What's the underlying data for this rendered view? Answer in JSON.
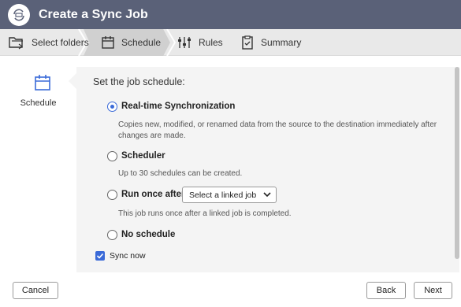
{
  "window": {
    "title": "Create a Sync Job"
  },
  "steps": [
    {
      "label": "Select folders",
      "icon": "folders-icon"
    },
    {
      "label": "Schedule",
      "icon": "calendar-icon"
    },
    {
      "label": "Rules",
      "icon": "sliders-icon"
    },
    {
      "label": "Summary",
      "icon": "clipboard-icon"
    }
  ],
  "sidebar": {
    "label": "Schedule",
    "icon": "calendar-icon"
  },
  "schedule": {
    "heading": "Set the job schedule:",
    "options": [
      {
        "label": "Real-time Synchronization",
        "checked": true,
        "desc_line1": "Copies new, modified, or renamed data from the source to the destination immediately after",
        "desc_line2": "changes are made."
      },
      {
        "label": "Scheduler",
        "checked": false,
        "desc_line1": "Up to 30 schedules can be created."
      },
      {
        "label": "Run once after:",
        "checked": false,
        "desc_line1": "This job runs once after a linked job is completed.",
        "select_value": "Select a linked job"
      },
      {
        "label": "No schedule",
        "checked": false
      }
    ],
    "sync_now": {
      "label": "Sync now",
      "checked": true
    }
  },
  "footer": {
    "cancel": "Cancel",
    "back": "Back",
    "next": "Next"
  },
  "colors": {
    "titlebar": "#5a6178",
    "accent": "#3a6ad8",
    "panel": "#f4f4f4"
  }
}
